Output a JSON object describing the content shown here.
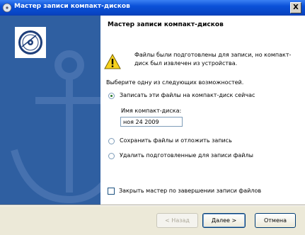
{
  "window": {
    "title": "Мастер записи компакт-дисков",
    "close_glyph": "X"
  },
  "wizard": {
    "heading": "Мастер записи компакт-дисков",
    "warning_text": "Файлы были подготовлены для записи, но компакт-диск был извлечен из устройства.",
    "prompt": "Выберите одну из следующих возможностей.",
    "options": [
      {
        "label": "Записать эти файлы на компакт-диск сейчас",
        "selected": true
      },
      {
        "label": "Сохранить файлы и отложить запись",
        "selected": false
      },
      {
        "label": "Удалить подготовленные для записи файлы",
        "selected": false
      }
    ],
    "cd_name_label": "Имя компакт-диска:",
    "cd_name_value": "ноя 24 2009",
    "close_checkbox_label": "Закрыть мастер по завершении записи файлов",
    "close_checkbox_checked": false
  },
  "buttons": {
    "back": "< Назад",
    "next": "Далее >",
    "cancel": "Отмена"
  },
  "icons": {
    "window": "cd-wizard-icon",
    "banner": "cd-disc-icon",
    "warning": "warning-icon",
    "watermark": "anchor-watermark"
  },
  "colors": {
    "titlebar": "#0a50d8",
    "side_panel": "#2f5fa1"
  }
}
